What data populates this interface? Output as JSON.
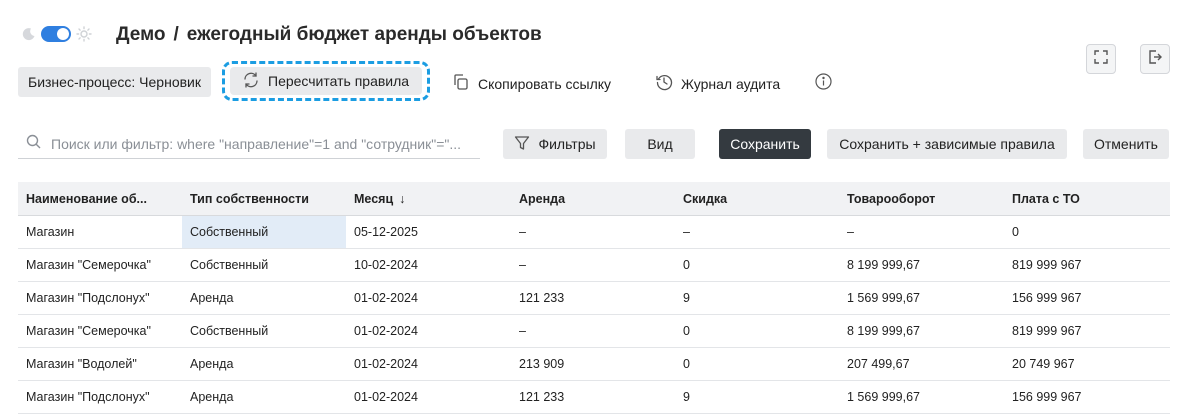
{
  "header": {
    "project": "Демо",
    "separator": "/",
    "title": "ежегодный бюджет аренды объектов"
  },
  "toolbar": {
    "bp_status": "Бизнес-процесс: Черновик",
    "recalc_label": "Пересчитать правила",
    "copy_link_label": "Скопировать ссылку",
    "audit_label": "Журнал аудита"
  },
  "filterbar": {
    "search_placeholder": "Поиск или фильтр: where \"направление\"=1 and \"сотрудник\"=\"...",
    "filters_label": "Фильтры",
    "view_label": "Вид",
    "save_label": "Сохранить",
    "save_dependent_label": "Сохранить + зависимые правила",
    "cancel_label": "Отменить"
  },
  "colors": {
    "accent": "#2f7fe0",
    "highlight": "#1b9de2",
    "save_button": "#343a40",
    "selected_cell": "#e2ecf7"
  },
  "icons": [
    "moon-icon",
    "sun-icon",
    "refresh-icon",
    "copy-icon",
    "history-icon",
    "info-icon",
    "search-icon",
    "filter-icon",
    "fullscreen-icon",
    "exit-icon"
  ],
  "table": {
    "columns": [
      "Наименование об...",
      "Тип собственности",
      "Месяц",
      "Аренда",
      "Скидка",
      "Товарооборот",
      "Плата с ТО"
    ],
    "sort_indicator": "↓",
    "rows": [
      [
        "Магазин",
        "Собственный",
        "05-12-2025",
        "–",
        "–",
        "–",
        "0"
      ],
      [
        "Магазин \"Семерочка\"",
        "Собственный",
        "10-02-2024",
        "–",
        "0",
        "8 199 999,67",
        "819 999 967"
      ],
      [
        "Магазин \"Подслонух\"",
        "Аренда",
        "01-02-2024",
        "121 233",
        "9",
        "1 569 999,67",
        "156 999 967"
      ],
      [
        "Магазин \"Семерочка\"",
        "Собственный",
        "01-02-2024",
        "–",
        "0",
        "8 199 999,67",
        "819 999 967"
      ],
      [
        "Магазин \"Водолей\"",
        "Аренда",
        "01-02-2024",
        "213 909",
        "0",
        "207 499,67",
        "20 749 967"
      ],
      [
        "Магазин \"Подслонух\"",
        "Аренда",
        "01-02-2024",
        "121 233",
        "9",
        "1 569 999,67",
        "156 999 967"
      ]
    ]
  }
}
